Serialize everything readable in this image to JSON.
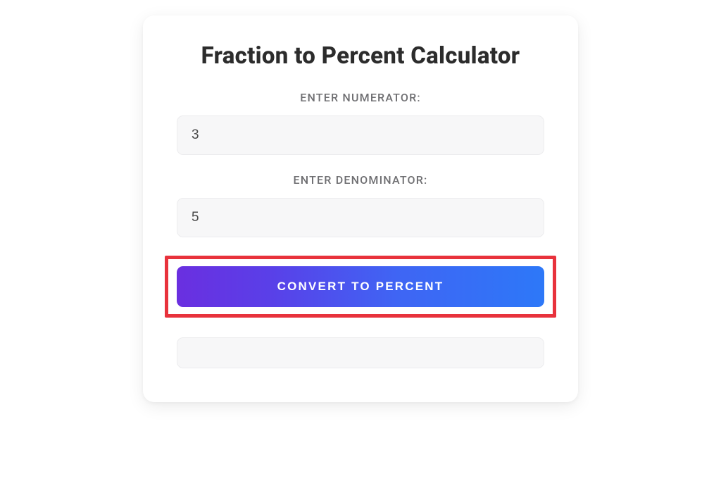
{
  "card": {
    "title": "Fraction to Percent Calculator",
    "numerator": {
      "label": "ENTER NUMERATOR:",
      "value": "3"
    },
    "denominator": {
      "label": "ENTER DENOMINATOR:",
      "value": "5"
    },
    "button_label": "CONVERT TO PERCENT",
    "result_value": ""
  },
  "colors": {
    "highlight_border": "#e8323c",
    "gradient_start": "#6a2fe0",
    "gradient_end": "#2d78f8"
  }
}
